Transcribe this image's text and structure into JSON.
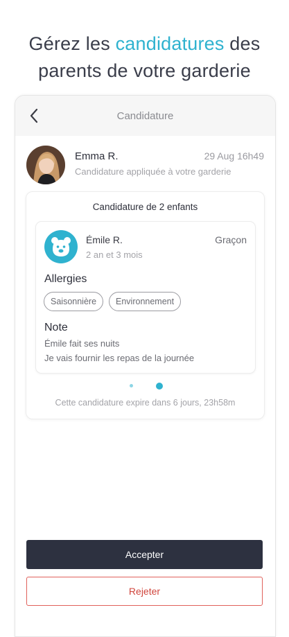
{
  "headline": {
    "line1_prefix": "Gérez les ",
    "line1_accent": "candidatures",
    "line1_suffix": " des",
    "line2": "parents de votre garderie"
  },
  "appbar": {
    "title": "Candidature",
    "back_icon": "chevron-left-icon"
  },
  "applicant": {
    "name": "Emma R.",
    "date": "29 Aug 16h49",
    "subtitle": "Candidature appliquée à votre garderie"
  },
  "application": {
    "title": "Candidature de 2 enfants",
    "child": {
      "name": "Émile R.",
      "age": "2 an et 3 mois",
      "gender": "Graçon",
      "avatar_icon": "bear-face-icon",
      "allergies_title": "Allergies",
      "allergies": [
        "Saisonnière",
        "Environnement"
      ],
      "note_title": "Note",
      "note_lines": [
        "Émile fait ses nuits",
        "Je vais fournir les repas de la journée"
      ]
    },
    "pager": {
      "count": 2,
      "active_index": 1
    },
    "expire_text": "Cette candidature expire dans 6 jours, 23h58m"
  },
  "actions": {
    "accept_label": "Accepter",
    "reject_label": "Rejeter"
  },
  "colors": {
    "accent": "#2fb2cf",
    "dark_button": "#2d3140",
    "reject_red": "#d0453c",
    "appbar_bg": "#f6f6f6"
  }
}
